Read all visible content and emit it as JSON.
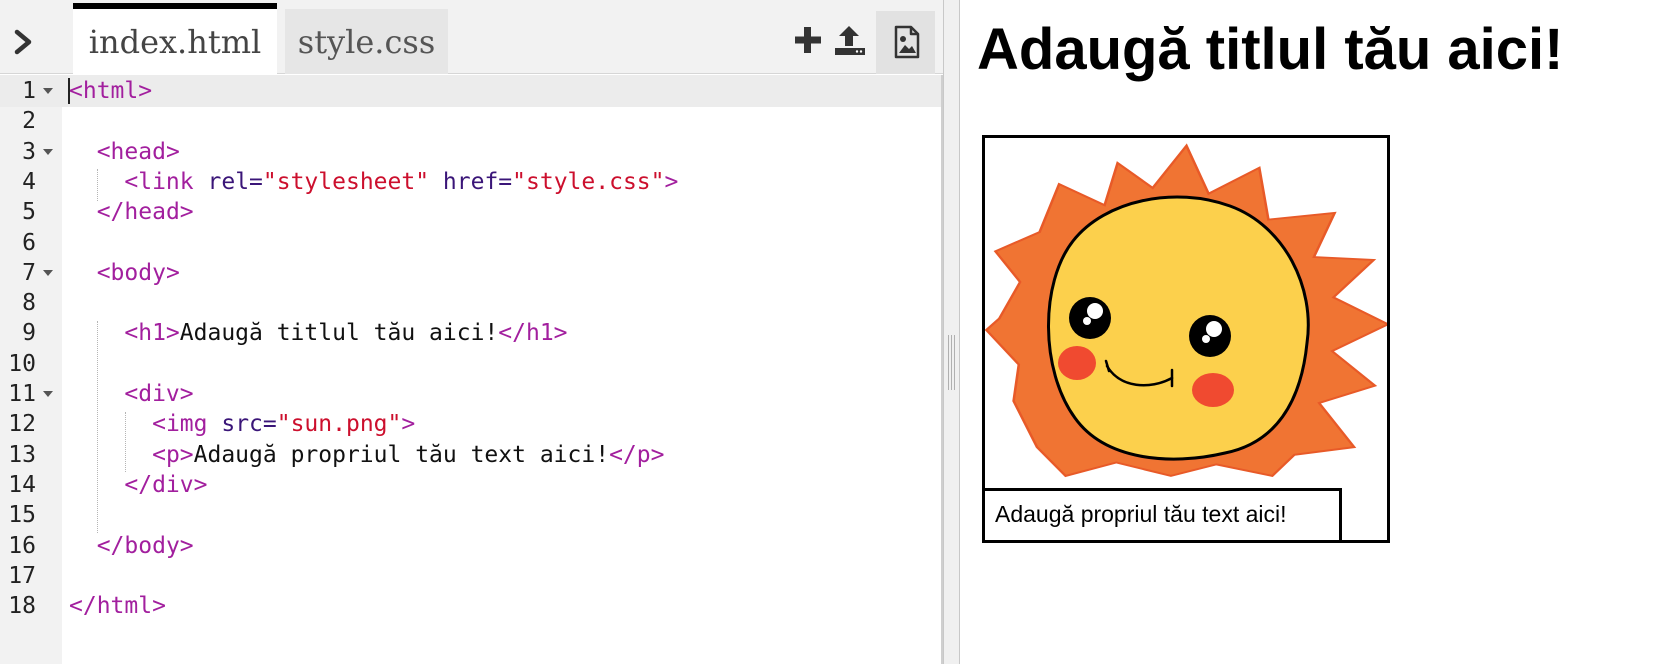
{
  "tabs": [
    {
      "label": "index.html",
      "active": true
    },
    {
      "label": "style.css",
      "active": false
    }
  ],
  "toolbar": {
    "add_icon": "plus-icon",
    "upload_icon": "upload-icon",
    "image_icon": "image-icon",
    "collapse_icon": "chevron-right-icon"
  },
  "editor": {
    "active_line": 1,
    "lines": [
      {
        "n": "1",
        "fold": true
      },
      {
        "n": "2",
        "fold": false
      },
      {
        "n": "3",
        "fold": true
      },
      {
        "n": "4",
        "fold": false
      },
      {
        "n": "5",
        "fold": false
      },
      {
        "n": "6",
        "fold": false
      },
      {
        "n": "7",
        "fold": true
      },
      {
        "n": "8",
        "fold": false
      },
      {
        "n": "9",
        "fold": false
      },
      {
        "n": "10",
        "fold": false
      },
      {
        "n": "11",
        "fold": true
      },
      {
        "n": "12",
        "fold": false
      },
      {
        "n": "13",
        "fold": false
      },
      {
        "n": "14",
        "fold": false
      },
      {
        "n": "15",
        "fold": false
      },
      {
        "n": "16",
        "fold": false
      },
      {
        "n": "17",
        "fold": false
      },
      {
        "n": "18",
        "fold": false
      }
    ],
    "code": {
      "l1_tag": "<html>",
      "l3_tag": "<head>",
      "l4_open": "<link",
      "l4_attr1": "rel=",
      "l4_val1": "\"stylesheet\"",
      "l4_attr2": "href=",
      "l4_val2": "\"style.css\"",
      "l4_close": ">",
      "l5_tag": "</head>",
      "l7_tag": "<body>",
      "l9_open": "<h1>",
      "l9_text": "Adaugă titlul tău aici!",
      "l9_close": "</h1>",
      "l11_tag": "<div>",
      "l12_open": "<img",
      "l12_attr": "src=",
      "l12_val": "\"sun.png\"",
      "l12_close": ">",
      "l13_open": "<p>",
      "l13_text": "Adaugă propriul tău text aici!",
      "l13_close": "</p>",
      "l14_tag": "</div>",
      "l16_tag": "</body>",
      "l18_tag": "</html>"
    }
  },
  "preview": {
    "title": "Adaugă titlul tău aici!",
    "image_name": "sun-image",
    "caption": "Adaugă propriul tău text aici!"
  },
  "colors": {
    "tag": "#a21f9e",
    "attribute": "#3a1578",
    "string": "#cc0f2d",
    "sun_rays": "#f07433",
    "sun_face": "#fcd04c",
    "cheeks": "#f04a30"
  }
}
